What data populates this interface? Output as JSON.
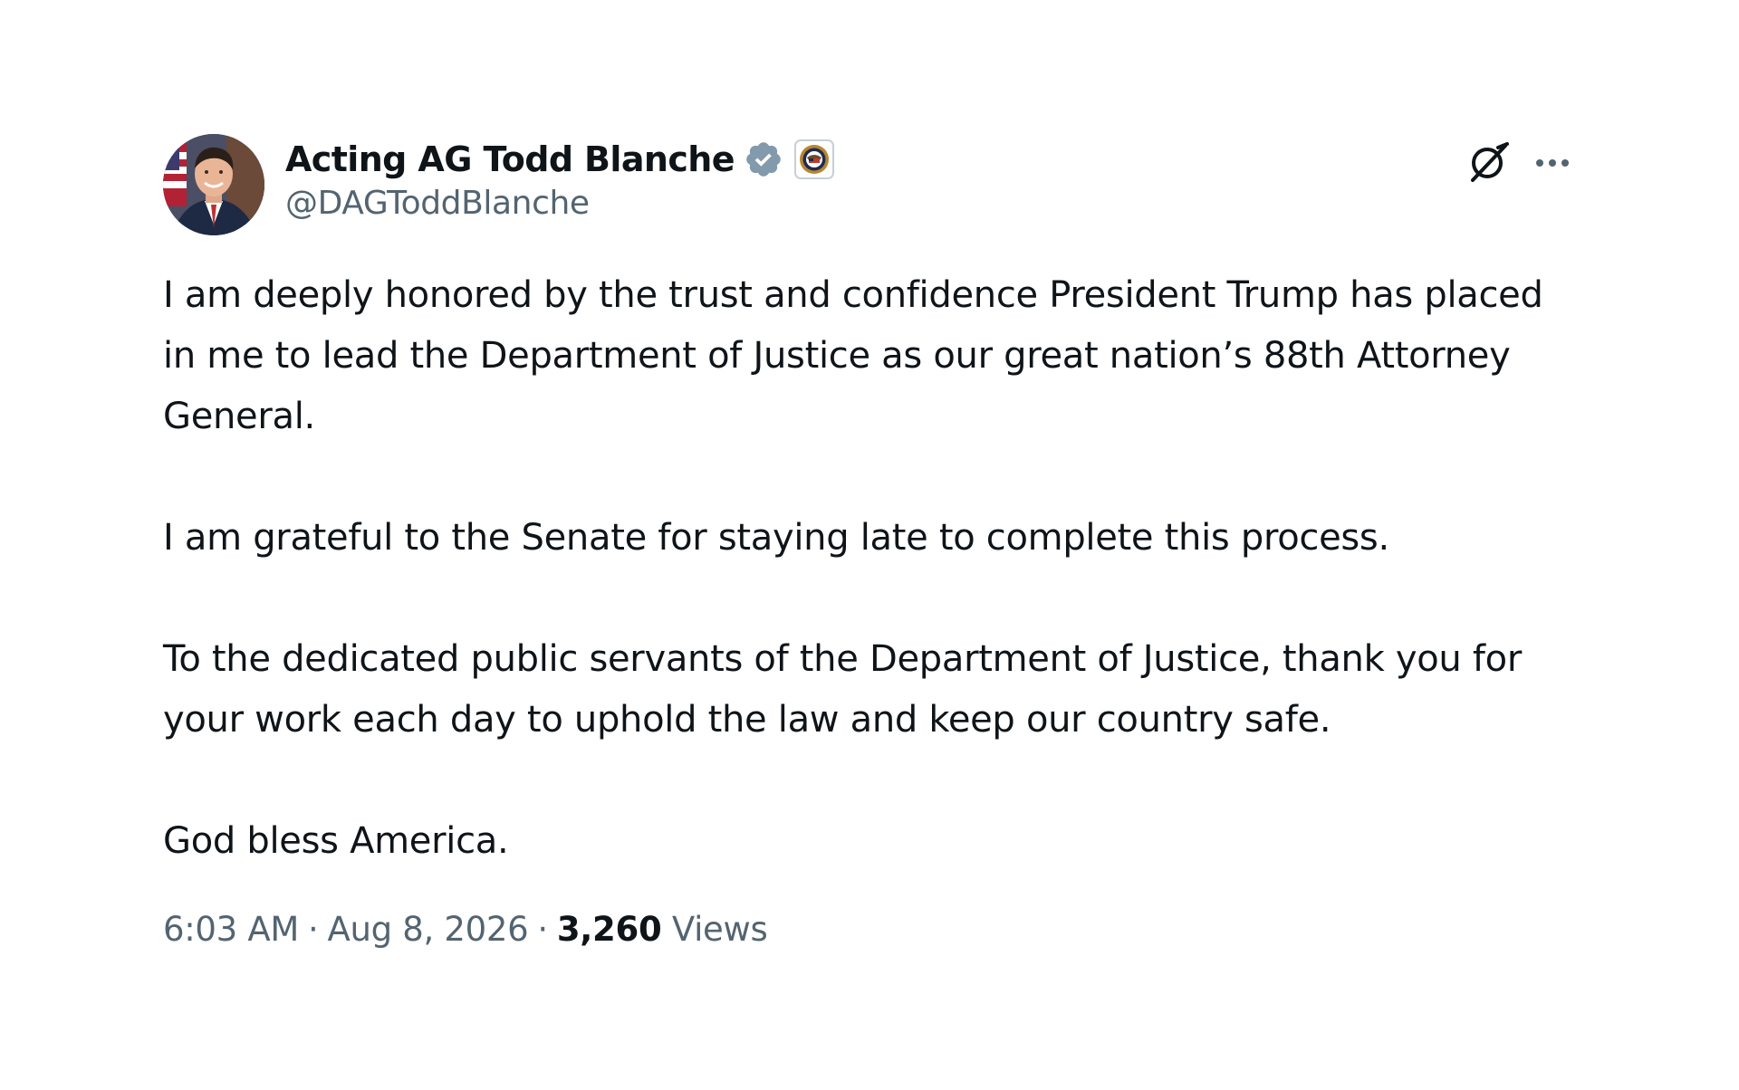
{
  "author": {
    "display_name": "Acting AG Todd Blanche",
    "handle": "@DAGToddBlanche",
    "verified": true,
    "verified_badge_color": "#829aab",
    "affiliate_badge": "seal-icon"
  },
  "actions": {
    "grok_icon": "grok-icon",
    "more_icon": "more-icon"
  },
  "post": {
    "paragraphs": [
      "I am deeply honored by the trust and confidence President Trump has placed in me to lead the Department of Justice as our great nation’s 88th Attorney General.",
      "I am grateful to the Senate for staying late to complete this process.",
      "To the dedicated public servants of the Department of Justice, thank you for your work each day to uphold the law and keep our country safe.",
      "God bless America."
    ]
  },
  "meta": {
    "time": "6:03 AM",
    "separator": "·",
    "date": "Aug 8, 2026",
    "views_count": "3,260",
    "views_label": "Views"
  }
}
